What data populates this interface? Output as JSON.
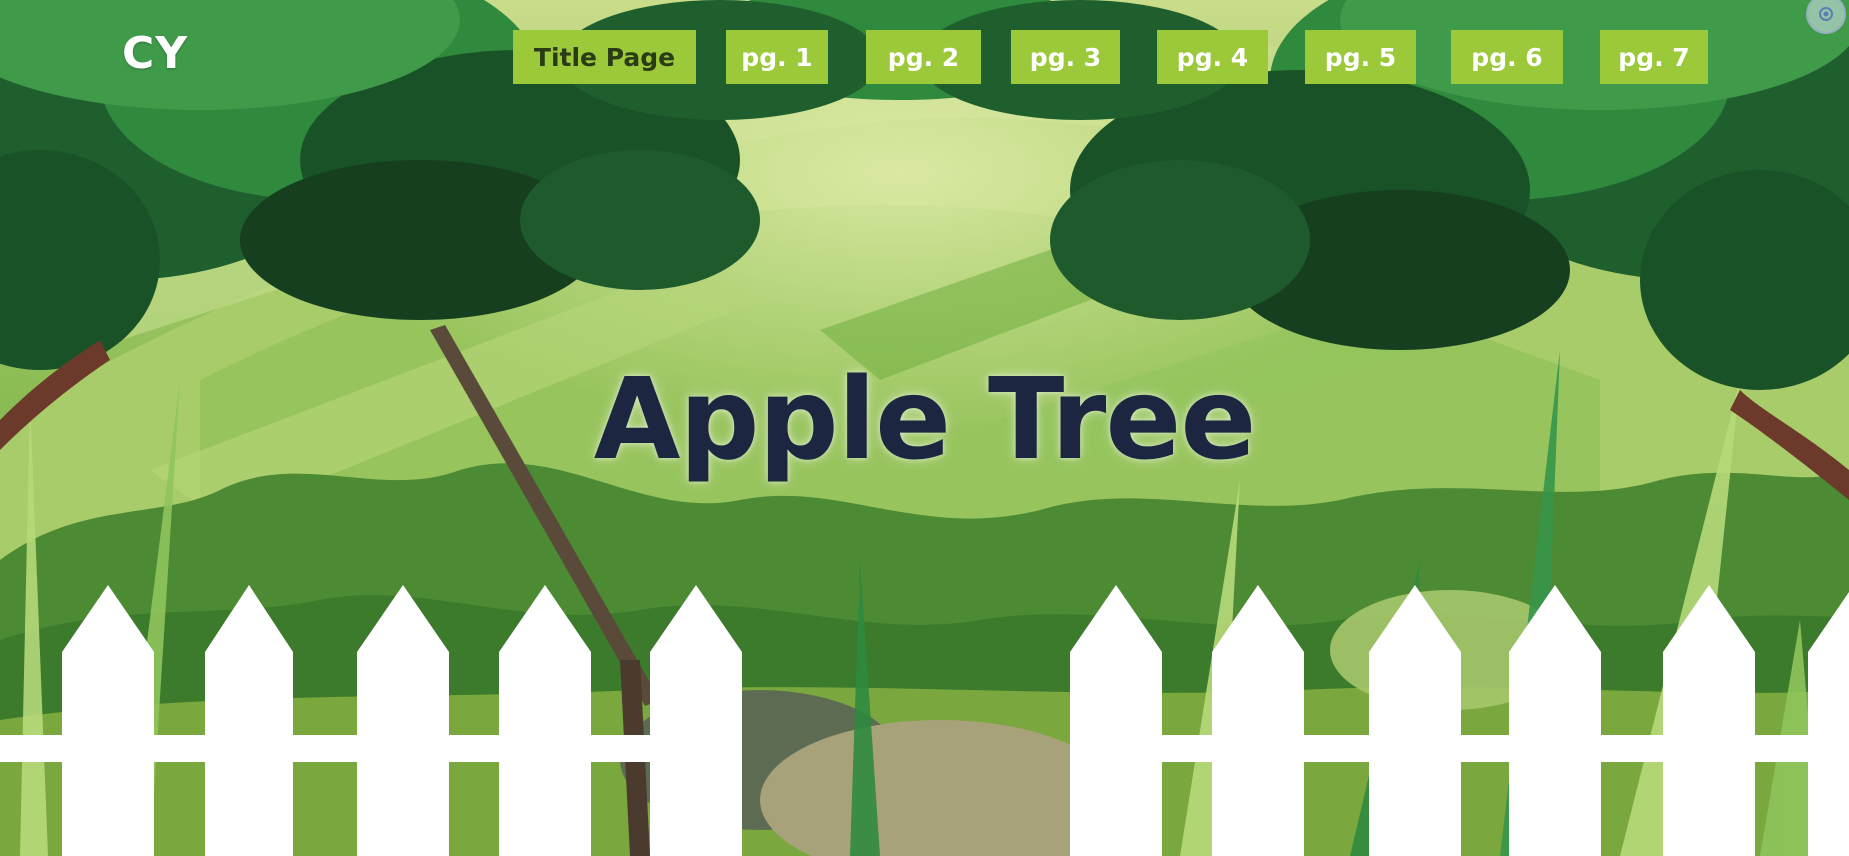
{
  "brand": {
    "logo_text": "CY"
  },
  "nav": {
    "items": [
      {
        "label": "Title Page",
        "active": true
      },
      {
        "label": "pg. 1",
        "active": false
      },
      {
        "label": "pg. 2",
        "active": false
      },
      {
        "label": "pg. 3",
        "active": false
      },
      {
        "label": "pg. 4",
        "active": false
      },
      {
        "label": "pg. 5",
        "active": false
      },
      {
        "label": "pg. 6",
        "active": false
      },
      {
        "label": "pg. 7",
        "active": false
      }
    ]
  },
  "hero": {
    "title": "Apple Tree"
  },
  "colors": {
    "nav_button": "#9bc93a",
    "title_text": "#1c2640",
    "fence": "#ffffff",
    "foliage_dark": "#1f5f2e",
    "foliage_mid": "#2f8a3e",
    "hill_light": "#b9d77a"
  },
  "icons": {
    "corner": "settings-gear-icon"
  }
}
